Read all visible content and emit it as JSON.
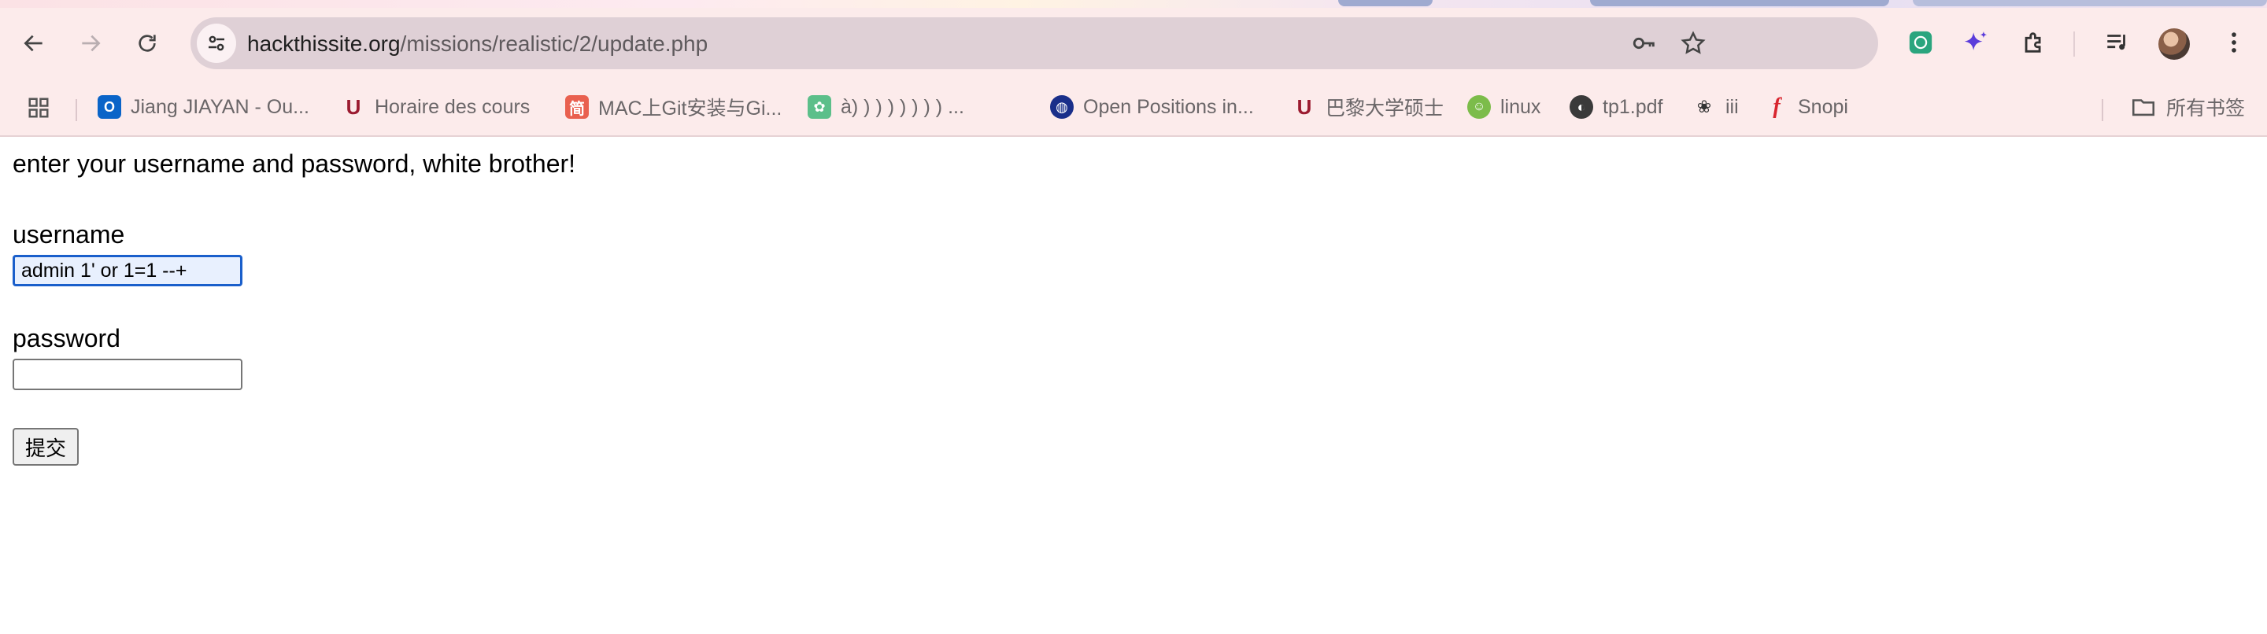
{
  "browser": {
    "url_host": "hackthissite.org",
    "url_path": "/missions/realistic/2/update.php",
    "bookmarks": [
      {
        "label": "Jiang JIAYAN - Ou...",
        "icon": "outlook-icon",
        "color": "#0a64c8",
        "glyph": "O"
      },
      {
        "label": "Horaire des cours",
        "icon": "university-logo-icon",
        "color": "#9b1b30",
        "glyph": "U"
      },
      {
        "label": "MAC上Git安装与Gi...",
        "icon": "jianshu-icon",
        "color": "#e9604f",
        "glyph": "简"
      },
      {
        "label": "à) ) ) ) ) ) ) ) ...",
        "icon": "paw-icon",
        "color": "#5cbf8a",
        "glyph": "✿"
      },
      {
        "label": "Open Positions in...",
        "icon": "globe-institution-icon",
        "color": "#1a2f8a",
        "glyph": "◍"
      },
      {
        "label": "巴黎大学硕士",
        "icon": "university-logo-icon",
        "color": "#9b1b30",
        "glyph": "U"
      },
      {
        "label": "linux",
        "icon": "linux-icon",
        "color": "#7cbc4a",
        "glyph": "☺"
      },
      {
        "label": "tp1.pdf",
        "icon": "globe-icon",
        "color": "#3a3a3a",
        "glyph": "◐"
      },
      {
        "label": "iii",
        "icon": "openai-icon",
        "color": "#ffffff",
        "glyph": "❀"
      },
      {
        "label": "Snopi",
        "icon": "snopi-icon",
        "color": "#ffffff",
        "glyph": "f"
      }
    ],
    "all_bookmarks_label": "所有书签"
  },
  "page": {
    "intro": "enter your username and password, white brother!",
    "username_label": "username",
    "username_value": "admin 1' or 1=1 --+",
    "password_label": "password",
    "password_value": "",
    "submit_label": "提交"
  }
}
